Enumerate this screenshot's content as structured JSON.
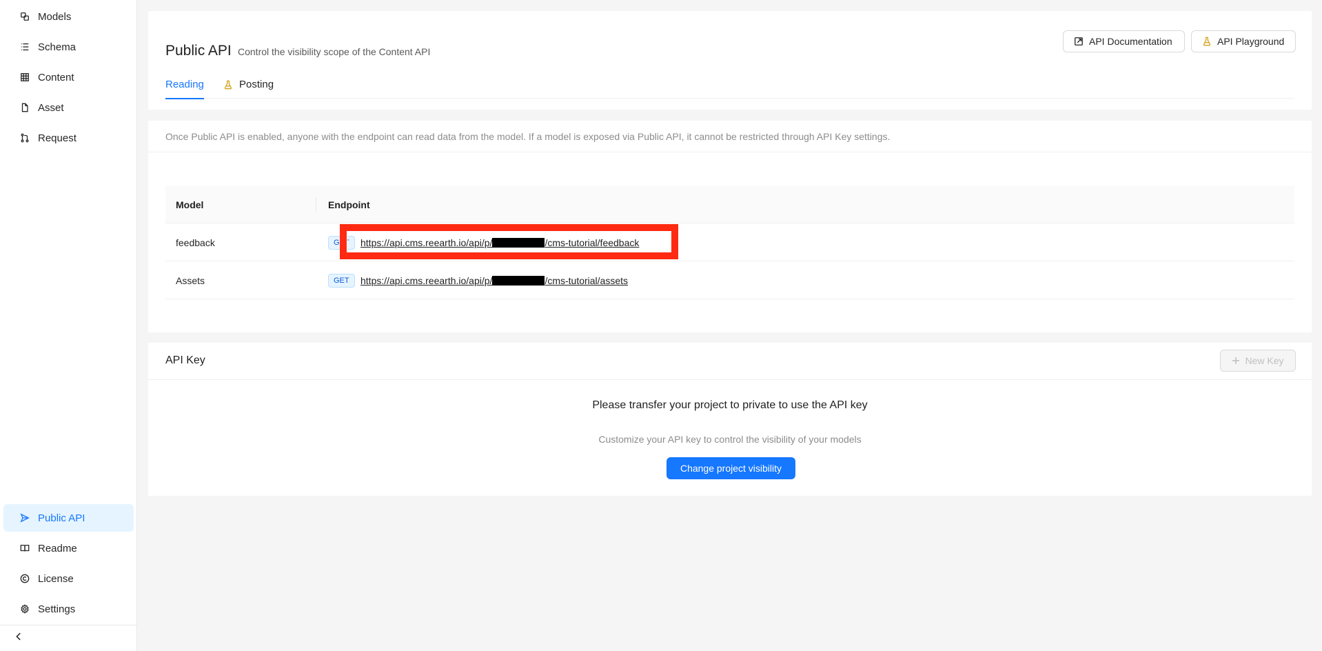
{
  "sidebar": {
    "top_items": [
      {
        "label": "Models",
        "icon": "models-icon"
      },
      {
        "label": "Schema",
        "icon": "schema-list-icon"
      },
      {
        "label": "Content",
        "icon": "table-icon"
      },
      {
        "label": "Asset",
        "icon": "file-icon"
      },
      {
        "label": "Request",
        "icon": "pull-request-icon"
      }
    ],
    "bottom_items": [
      {
        "label": "Public API",
        "icon": "send-icon",
        "active": true
      },
      {
        "label": "Readme",
        "icon": "book-icon"
      },
      {
        "label": "License",
        "icon": "copyright-icon"
      },
      {
        "label": "Settings",
        "icon": "gear-icon"
      }
    ],
    "collapse_icon": "chevron-left-icon"
  },
  "header": {
    "title": "Public API",
    "subtitle": "Control the visibility scope of the Content API",
    "api_doc_label": "API Documentation",
    "api_playground_label": "API Playground",
    "tabs": [
      {
        "label": "Reading",
        "active": true
      },
      {
        "label": "Posting",
        "icon": "beaker-icon"
      }
    ]
  },
  "public_api": {
    "notice": "Once Public API is enabled, anyone with the endpoint can read data from the model. If a model is exposed via Public API, it cannot be restricted through API Key settings.",
    "columns": [
      "Model",
      "Endpoint"
    ],
    "rows": [
      {
        "model": "feedback",
        "method": "GET",
        "url_prefix": "https://api.cms.reearth.io/api/p/",
        "url_suffix": "/cms-tutorial/feedback"
      },
      {
        "model": "Assets",
        "method": "GET",
        "url_prefix": "https://api.cms.reearth.io/api/p/",
        "url_suffix": "/cms-tutorial/assets"
      }
    ]
  },
  "api_key": {
    "title": "API Key",
    "new_key_label": "New Key",
    "empty_title": "Please transfer your project to private to use the API key",
    "empty_desc": "Customize your API key to control the visibility of your models",
    "change_visibility_label": "Change project visibility"
  },
  "colors": {
    "accent": "#1677ff",
    "highlight": "#ff2a12",
    "active_bg": "#e6f4ff"
  }
}
